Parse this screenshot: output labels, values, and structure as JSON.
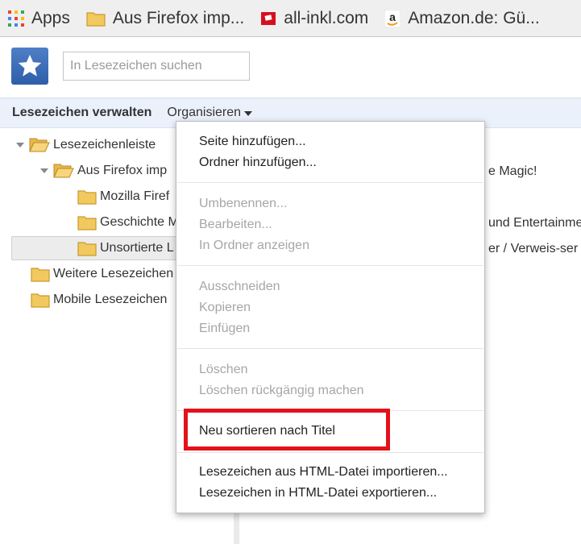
{
  "bookmarks_bar": {
    "items": [
      {
        "label": "Apps",
        "icon": "apps-grid-icon"
      },
      {
        "label": "Aus Firefox imp...",
        "icon": "folder-icon"
      },
      {
        "label": "all-inkl.com",
        "icon": "all-inkl-logo-icon"
      },
      {
        "label": "Amazon.de: Gü...",
        "icon": "amazon-logo-icon"
      }
    ]
  },
  "search": {
    "placeholder": "In Lesezeichen suchen",
    "value": ""
  },
  "toolbar": {
    "title": "Lesezeichen verwalten",
    "organize_label": "Organisieren"
  },
  "tree": {
    "items": [
      {
        "label": "Lesezeichenleiste",
        "expanded": true
      },
      {
        "label": "Aus Firefox imp",
        "expanded": true
      },
      {
        "label": "Mozilla Firef"
      },
      {
        "label": "Geschichte M"
      },
      {
        "label": "Unsortierte L",
        "selected": true
      },
      {
        "label": "Weitere Lesezeichen"
      },
      {
        "label": "Mobile Lesezeichen"
      }
    ]
  },
  "list_peek": [
    "e Magic!",
    "und Entertainme",
    "er / Verweis-ser"
  ],
  "menu": {
    "groups": [
      [
        {
          "label": "Seite hinzufügen...",
          "enabled": true
        },
        {
          "label": "Ordner hinzufügen...",
          "enabled": true
        }
      ],
      [
        {
          "label": "Umbenennen...",
          "enabled": false
        },
        {
          "label": "Bearbeiten...",
          "enabled": false
        },
        {
          "label": "In Ordner anzeigen",
          "enabled": false
        }
      ],
      [
        {
          "label": "Ausschneiden",
          "enabled": false
        },
        {
          "label": "Kopieren",
          "enabled": false
        },
        {
          "label": "Einfügen",
          "enabled": false
        }
      ],
      [
        {
          "label": "Löschen",
          "enabled": false
        },
        {
          "label": "Löschen rückgängig machen",
          "enabled": false
        }
      ],
      [
        {
          "label": "Neu sortieren nach Titel",
          "enabled": true,
          "highlighted": true
        }
      ],
      [
        {
          "label": "Lesezeichen aus HTML-Datei importieren...",
          "enabled": true
        },
        {
          "label": "Lesezeichen in HTML-Datei exportieren...",
          "enabled": true
        }
      ]
    ]
  },
  "colors": {
    "highlight_box": "#e3131b",
    "toolbar_bg": "#ebf1fb",
    "folder": "#f2c95e"
  }
}
